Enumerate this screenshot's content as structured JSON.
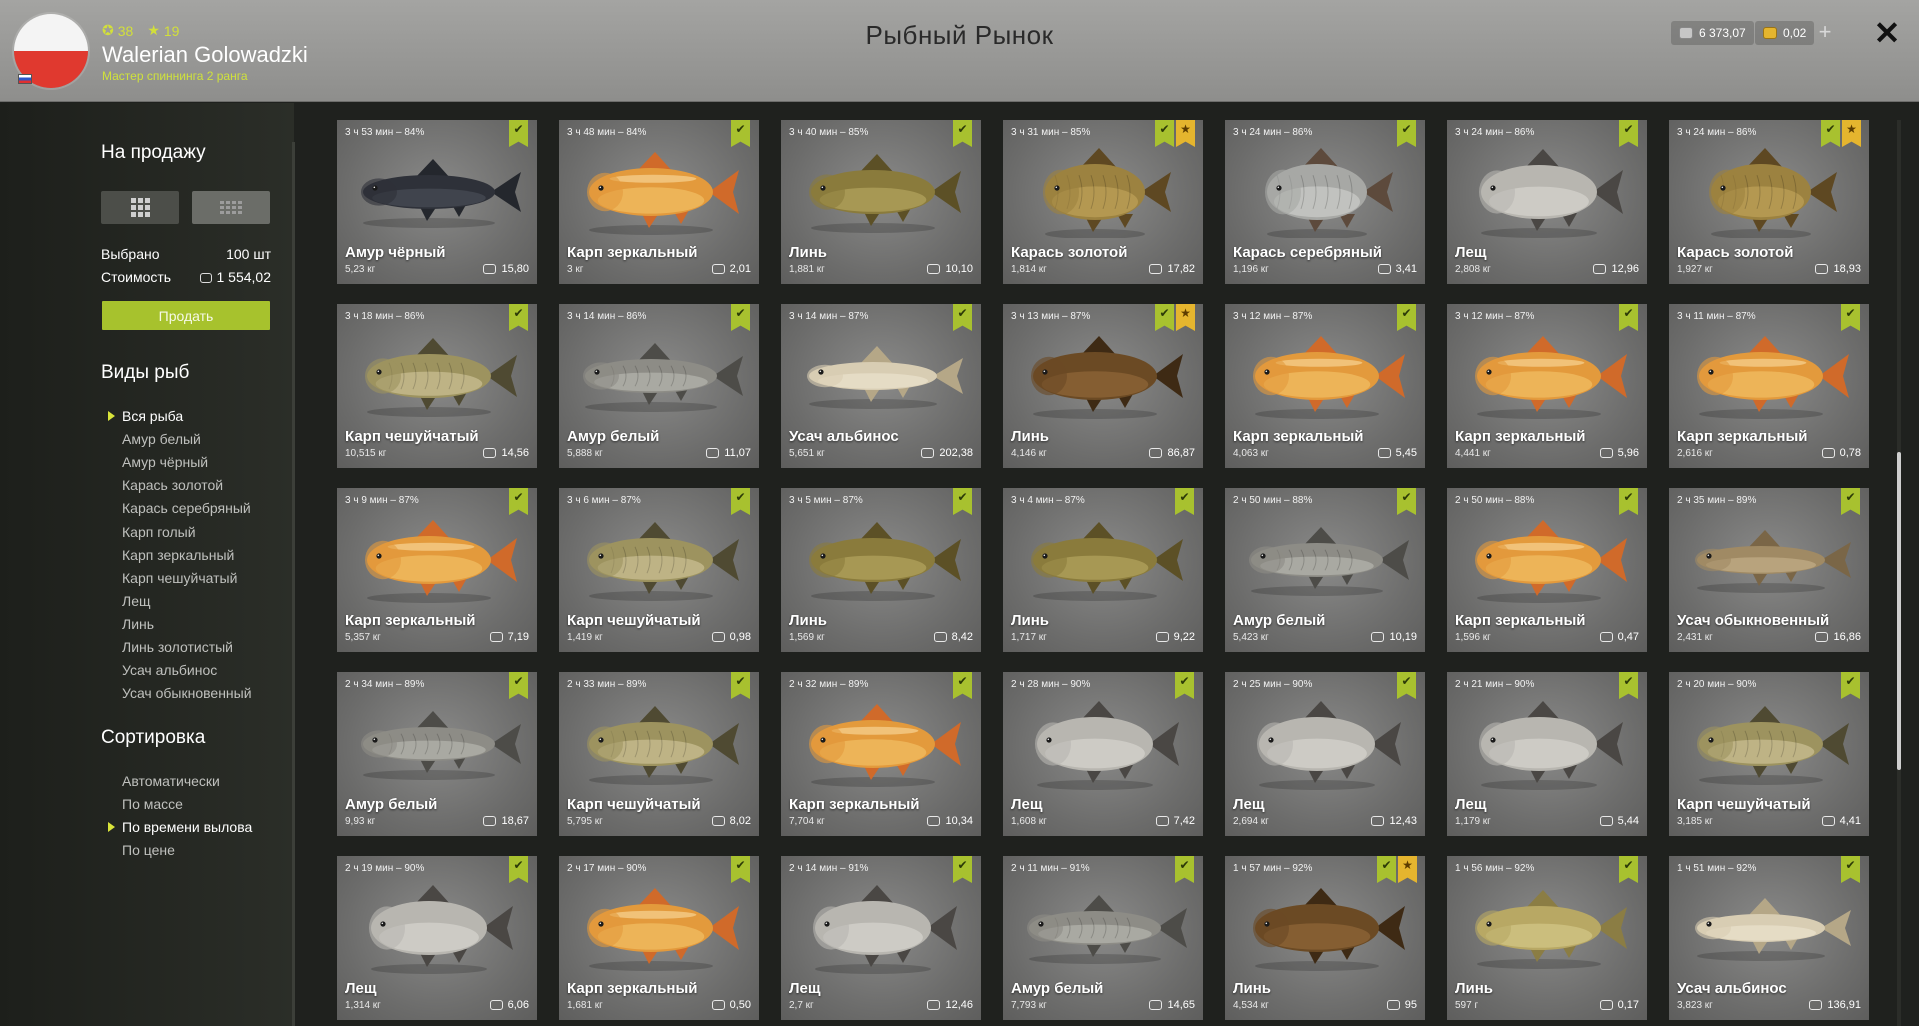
{
  "header": {
    "title": "Рыбный Рынок",
    "player_name": "Walerian Golowadzki",
    "player_rank": "Мастер спиннинга 2 ранга",
    "level": "38",
    "stars": "19",
    "silver": "6 373,07",
    "gold": "0,02",
    "plus_label": "+",
    "close_label": "✕"
  },
  "sidebar": {
    "sale_title": "На продажу",
    "selected_label": "Выбрано",
    "selected_value": "100 шт",
    "cost_label": "Стоимость",
    "cost_value": "1 554,02",
    "sell_button": "Продать",
    "species_title": "Виды рыб",
    "species": [
      {
        "label": "Вся рыба",
        "selected": true
      },
      {
        "label": "Амур белый",
        "selected": false
      },
      {
        "label": "Амур чёрный",
        "selected": false
      },
      {
        "label": "Карась золотой",
        "selected": false
      },
      {
        "label": "Карась серебряный",
        "selected": false
      },
      {
        "label": "Карп голый",
        "selected": false
      },
      {
        "label": "Карп зеркальный",
        "selected": false
      },
      {
        "label": "Карп чешуйчатый",
        "selected": false
      },
      {
        "label": "Лещ",
        "selected": false
      },
      {
        "label": "Линь",
        "selected": false
      },
      {
        "label": "Линь золотистый",
        "selected": false
      },
      {
        "label": "Усач альбинос",
        "selected": false
      },
      {
        "label": "Усач обыкновенный",
        "selected": false
      }
    ],
    "sort_title": "Сортировка",
    "sort": [
      {
        "label": "Автоматически",
        "selected": false
      },
      {
        "label": "По массе",
        "selected": false
      },
      {
        "label": "По времени вылова",
        "selected": true
      },
      {
        "label": "По цене",
        "selected": false
      }
    ]
  },
  "colors": {
    "accent": "#a7c22d",
    "star": "#e5b52e"
  },
  "icons": {
    "check": "check-badge-icon",
    "star": "star-badge-icon",
    "price": "silver-coin-icon"
  },
  "fish": [
    {
      "time": "3 ч 53 мин – 84%",
      "name": "Амур чёрный",
      "weight": "5,23 кг",
      "price": "15,80",
      "star": false,
      "kind": "black_amur"
    },
    {
      "time": "3 ч 48 мин – 84%",
      "name": "Карп зеркальный",
      "weight": "3 кг",
      "price": "2,01",
      "star": false,
      "kind": "mirror_carp"
    },
    {
      "time": "3 ч 40 мин – 85%",
      "name": "Линь",
      "weight": "1,881 кг",
      "price": "10,10",
      "star": false,
      "kind": "tench"
    },
    {
      "time": "3 ч 31 мин – 85%",
      "name": "Карась золотой",
      "weight": "1,814 кг",
      "price": "17,82",
      "star": true,
      "kind": "gold_crucian"
    },
    {
      "time": "3 ч 24 мин – 86%",
      "name": "Карась серебряный",
      "weight": "1,196 кг",
      "price": "3,41",
      "star": false,
      "kind": "silver_crucian"
    },
    {
      "time": "3 ч 24 мин – 86%",
      "name": "Лещ",
      "weight": "2,808 кг",
      "price": "12,96",
      "star": false,
      "kind": "bream"
    },
    {
      "time": "3 ч 24 мин – 86%",
      "name": "Карась золотой",
      "weight": "1,927 кг",
      "price": "18,93",
      "star": true,
      "kind": "gold_crucian"
    },
    {
      "time": "3 ч 18 мин – 86%",
      "name": "Карп чешуйчатый",
      "weight": "10,515 кг",
      "price": "14,56",
      "star": false,
      "kind": "common_carp"
    },
    {
      "time": "3 ч 14 мин – 86%",
      "name": "Амур белый",
      "weight": "5,888 кг",
      "price": "11,07",
      "star": false,
      "kind": "grass_carp"
    },
    {
      "time": "3 ч 14 мин – 87%",
      "name": "Усач альбинос",
      "weight": "5,651 кг",
      "price": "202,38",
      "star": false,
      "kind": "albino_barbel"
    },
    {
      "time": "3 ч 13 мин – 87%",
      "name": "Линь",
      "weight": "4,146 кг",
      "price": "86,87",
      "star": true,
      "kind": "tench_dark"
    },
    {
      "time": "3 ч 12 мин – 87%",
      "name": "Карп зеркальный",
      "weight": "4,063 кг",
      "price": "5,45",
      "star": false,
      "kind": "mirror_carp"
    },
    {
      "time": "3 ч 12 мин – 87%",
      "name": "Карп зеркальный",
      "weight": "4,441 кг",
      "price": "5,96",
      "star": false,
      "kind": "mirror_carp"
    },
    {
      "time": "3 ч 11 мин – 87%",
      "name": "Карп зеркальный",
      "weight": "2,616 кг",
      "price": "0,78",
      "star": false,
      "kind": "mirror_carp"
    },
    {
      "time": "3 ч 9 мин – 87%",
      "name": "Карп зеркальный",
      "weight": "5,357 кг",
      "price": "7,19",
      "star": false,
      "kind": "mirror_carp"
    },
    {
      "time": "3 ч 6 мин – 87%",
      "name": "Карп чешуйчатый",
      "weight": "1,419 кг",
      "price": "0,98",
      "star": false,
      "kind": "common_carp"
    },
    {
      "time": "3 ч 5 мин – 87%",
      "name": "Линь",
      "weight": "1,569 кг",
      "price": "8,42",
      "star": false,
      "kind": "tench"
    },
    {
      "time": "3 ч 4 мин – 87%",
      "name": "Линь",
      "weight": "1,717 кг",
      "price": "9,22",
      "star": false,
      "kind": "tench"
    },
    {
      "time": "2 ч 50 мин – 88%",
      "name": "Амур белый",
      "weight": "5,423 кг",
      "price": "10,19",
      "star": false,
      "kind": "grass_carp"
    },
    {
      "time": "2 ч 50 мин – 88%",
      "name": "Карп зеркальный",
      "weight": "1,596 кг",
      "price": "0,47",
      "star": false,
      "kind": "mirror_carp"
    },
    {
      "time": "2 ч 35 мин – 89%",
      "name": "Усач обыкновенный",
      "weight": "2,431 кг",
      "price": "16,86",
      "star": false,
      "kind": "barbel"
    },
    {
      "time": "2 ч 34 мин – 89%",
      "name": "Амур белый",
      "weight": "9,93 кг",
      "price": "18,67",
      "star": false,
      "kind": "grass_carp"
    },
    {
      "time": "2 ч 33 мин – 89%",
      "name": "Карп чешуйчатый",
      "weight": "5,795 кг",
      "price": "8,02",
      "star": false,
      "kind": "common_carp"
    },
    {
      "time": "2 ч 32 мин – 89%",
      "name": "Карп зеркальный",
      "weight": "7,704 кг",
      "price": "10,34",
      "star": false,
      "kind": "mirror_carp"
    },
    {
      "time": "2 ч 28 мин – 90%",
      "name": "Лещ",
      "weight": "1,608 кг",
      "price": "7,42",
      "star": false,
      "kind": "bream"
    },
    {
      "time": "2 ч 25 мин – 90%",
      "name": "Лещ",
      "weight": "2,694 кг",
      "price": "12,43",
      "star": false,
      "kind": "bream"
    },
    {
      "time": "2 ч 21 мин – 90%",
      "name": "Лещ",
      "weight": "1,179 кг",
      "price": "5,44",
      "star": false,
      "kind": "bream"
    },
    {
      "time": "2 ч 20 мин – 90%",
      "name": "Карп чешуйчатый",
      "weight": "3,185 кг",
      "price": "4,41",
      "star": false,
      "kind": "common_carp"
    },
    {
      "time": "2 ч 19 мин – 90%",
      "name": "Лещ",
      "weight": "1,314 кг",
      "price": "6,06",
      "star": false,
      "kind": "bream"
    },
    {
      "time": "2 ч 17 мин – 90%",
      "name": "Карп зеркальный",
      "weight": "1,681 кг",
      "price": "0,50",
      "star": false,
      "kind": "mirror_carp"
    },
    {
      "time": "2 ч 14 мин – 91%",
      "name": "Лещ",
      "weight": "2,7 кг",
      "price": "12,46",
      "star": false,
      "kind": "bream"
    },
    {
      "time": "2 ч 11 мин – 91%",
      "name": "Амур белый",
      "weight": "7,793 кг",
      "price": "14,65",
      "star": false,
      "kind": "grass_carp"
    },
    {
      "time": "1 ч 57 мин – 92%",
      "name": "Линь",
      "weight": "4,534 кг",
      "price": "95",
      "star": true,
      "kind": "tench_dark"
    },
    {
      "time": "1 ч 56 мин – 92%",
      "name": "Линь",
      "weight": "597 г",
      "price": "0,17",
      "star": false,
      "kind": "gold_tench"
    },
    {
      "time": "1 ч 51 мин – 92%",
      "name": "Усач альбинос",
      "weight": "3,823 кг",
      "price": "136,91",
      "star": false,
      "kind": "albino_barbel"
    }
  ]
}
